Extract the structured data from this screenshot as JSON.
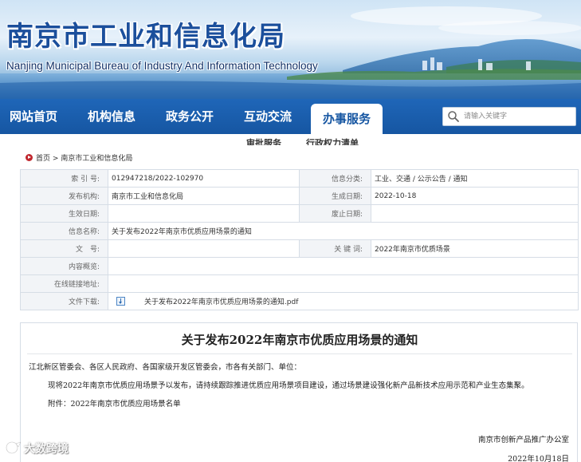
{
  "header": {
    "title": "南京市工业和信息化局",
    "subtitle": "Nanjing Municipal Bureau of Industry And Information Technology"
  },
  "nav": {
    "items": [
      {
        "label": "网站首页"
      },
      {
        "label": "机构信息"
      },
      {
        "label": "政务公开"
      },
      {
        "label": "互动交流"
      },
      {
        "label": "办事服务",
        "active": true
      }
    ],
    "search_placeholder": "请输入关键字",
    "sub_items": [
      "审批服务",
      "行政权力清单"
    ]
  },
  "breadcrumb": {
    "home": "首页",
    "separator": ">",
    "current": "南京市工业和信息化局"
  },
  "info": {
    "index_no_label": "索 引 号:",
    "index_no": "012947218/2022-102970",
    "category_label": "信息分类:",
    "category": "工业、交通 / 公示公告 / 通知",
    "publisher_label": "发布机构:",
    "publisher": "南京市工业和信息化局",
    "created_label": "生成日期:",
    "created": "2022-10-18",
    "effective_label": "生效日期:",
    "effective": "",
    "abolished_label": "废止日期:",
    "abolished": "",
    "name_label": "信息名称:",
    "name": "关于发布2022年南京市优质应用场景的通知",
    "doc_no_label": "文　号:",
    "doc_no": "",
    "keywords_label": "关 键 词:",
    "keywords": "2022年南京市优质场景",
    "summary_label": "内容概览:",
    "summary": "",
    "link_label": "在线链接地址:",
    "link": "",
    "download_label": "文件下载:",
    "download_file": "关于发布2022年南京市优质应用场景的通知.pdf"
  },
  "article": {
    "title": "关于发布2022年南京市优质应用场景的通知",
    "salutation": "江北新区管委会、各区人民政府、各国家级开发区管委会，市各有关部门、单位：",
    "body": "现将2022年南京市优质应用场景予以发布，请持续跟踪推进优质应用场景项目建设，通过场景建设强化新产品新技术应用示范和产业生态集聚。",
    "attachment": "附件：2022年南京市优质应用场景名单",
    "signature_org": "南京市创新产品推广办公室",
    "signature_date": "2022年10月18日"
  },
  "watermark": {
    "text": "大数跨境"
  },
  "colors": {
    "nav_bg": "#1656a2",
    "title_blue": "#1b4f9c",
    "home_red": "#c0262d",
    "table_border": "#d6dde6",
    "label_bg": "#f2f4f7"
  }
}
